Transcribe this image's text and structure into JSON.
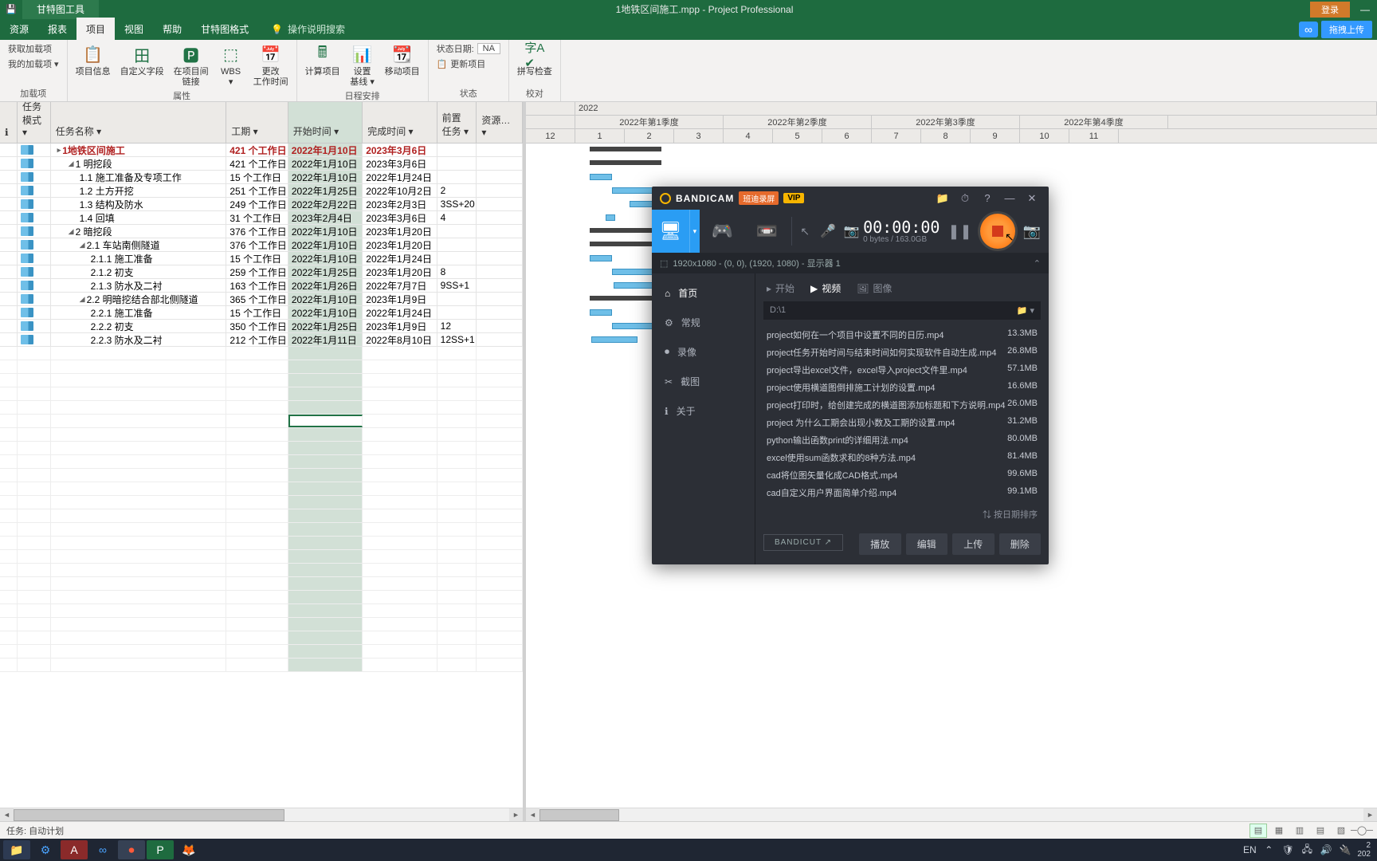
{
  "titlebar": {
    "contextual_tab": "甘特图工具",
    "title": "1地铁区间施工.mpp  -  Project Professional",
    "login": "登录"
  },
  "menu": {
    "tabs": [
      "资源",
      "报表",
      "项目",
      "视图",
      "帮助",
      "甘特图格式"
    ],
    "active_index": 2,
    "search_placeholder": "操作说明搜索",
    "upload": "拖拽上传"
  },
  "ribbon": {
    "g1": {
      "b1": "获取加载项",
      "b2": "我的加载项 ▾",
      "label": "加载项"
    },
    "g2": {
      "b1": "项目信息",
      "b2": "自定义字段",
      "b3": "在项目间\n链接",
      "b4": "WBS\n▾",
      "b5": "更改\n工作时间",
      "label": "属性"
    },
    "g3": {
      "b1": "计算项目",
      "b2": "设置\n基线 ▾",
      "b3": "移动项目",
      "label": "日程安排"
    },
    "g4": {
      "r1": "状态日期:",
      "r1v": "NA",
      "r2": "更新项目",
      "label": "状态"
    },
    "g5": {
      "b1": "拼写检查",
      "label": "校对"
    }
  },
  "columns": {
    "indicator": "",
    "mode": "任务模式 ▾",
    "name": "任务名称 ▾",
    "duration": "工期 ▾",
    "start": "开始时间 ▾",
    "finish": "完成时间 ▾",
    "pred": "前置\n任务 ▾",
    "res": "资源… ▾"
  },
  "tasks": [
    {
      "lvl": 0,
      "sum": true,
      "name": "1地铁区间施工",
      "dur": "421 个工作日",
      "start": "2022年1月10日",
      "finish": "2023年3月6日",
      "pred": "",
      "toggle": "▸"
    },
    {
      "lvl": 1,
      "sum": true,
      "name": "1 明挖段",
      "dur": "421 个工作日",
      "start": "2022年1月10日",
      "finish": "2023年3月6日",
      "pred": "",
      "toggle": "◢"
    },
    {
      "lvl": 2,
      "name": "1.1 施工准备及专项工作",
      "dur": "15 个工作日",
      "start": "2022年1月10日",
      "finish": "2022年1月24日",
      "pred": ""
    },
    {
      "lvl": 2,
      "name": "1.2 土方开挖",
      "dur": "251 个工作日",
      "start": "2022年1月25日",
      "finish": "2022年10月2日",
      "pred": "2"
    },
    {
      "lvl": 2,
      "name": "1.3 结构及防水",
      "dur": "249 个工作日",
      "start": "2022年2月22日",
      "finish": "2023年2月3日",
      "pred": "3SS+20"
    },
    {
      "lvl": 2,
      "name": "1.4 回填",
      "dur": "31 个工作日",
      "start": "2023年2月4日",
      "finish": "2023年3月6日",
      "pred": "4"
    },
    {
      "lvl": 1,
      "sum": true,
      "name": "2 暗挖段",
      "dur": "376 个工作日",
      "start": "2022年1月10日",
      "finish": "2023年1月20日",
      "pred": "",
      "toggle": "◢"
    },
    {
      "lvl": 2,
      "sum": true,
      "name": "2.1 车站南侧隧道",
      "dur": "376 个工作日",
      "start": "2022年1月10日",
      "finish": "2023年1月20日",
      "pred": "",
      "toggle": "◢"
    },
    {
      "lvl": 3,
      "name": "2.1.1 施工准备",
      "dur": "15 个工作日",
      "start": "2022年1月10日",
      "finish": "2022年1月24日",
      "pred": ""
    },
    {
      "lvl": 3,
      "name": "2.1.2 初支",
      "dur": "259 个工作日",
      "start": "2022年1月25日",
      "finish": "2023年1月20日",
      "pred": "8"
    },
    {
      "lvl": 3,
      "name": "2.1.3 防水及二衬",
      "dur": "163 个工作日",
      "start": "2022年1月26日",
      "finish": "2022年7月7日",
      "pred": "9SS+1"
    },
    {
      "lvl": 2,
      "sum": true,
      "name": "2.2 明暗挖结合部北侧隧道",
      "dur": "365 个工作日",
      "start": "2022年1月10日",
      "finish": "2023年1月9日",
      "pred": "",
      "toggle": "◢"
    },
    {
      "lvl": 3,
      "name": "2.2.1 施工准备",
      "dur": "15 个工作日",
      "start": "2022年1月10日",
      "finish": "2022年1月24日",
      "pred": ""
    },
    {
      "lvl": 3,
      "name": "2.2.2 初支",
      "dur": "350 个工作日",
      "start": "2022年1月25日",
      "finish": "2023年1月9日",
      "pred": "12"
    },
    {
      "lvl": 3,
      "name": "2.2.3 防水及二衬",
      "dur": "212 个工作日",
      "start": "2022年1月11日",
      "finish": "2022年8月10日",
      "pred": "12SS+1"
    }
  ],
  "timescale": {
    "year": "2022",
    "quarters": [
      "2022年第1季度",
      "2022年第2季度",
      "2022年第3季度",
      "2022年第4季度"
    ],
    "months": [
      "12",
      "1",
      "2",
      "3",
      "4",
      "5",
      "6",
      "7",
      "8",
      "9",
      "10",
      "11"
    ]
  },
  "bandicam": {
    "brand": "BANDICAM",
    "subtitle": "班迪录屏",
    "vip": "VIP",
    "timer": "00:00:00",
    "bytes": "0 bytes / 163.0GB",
    "capture_info": "1920x1080 - (0, 0), (1920, 1080) - 显示器 1",
    "side": [
      {
        "icon": "⌂",
        "label": "首页",
        "active": true
      },
      {
        "icon": "⚙",
        "label": "常规"
      },
      {
        "icon": "⏺",
        "label": "录像"
      },
      {
        "icon": "✂",
        "label": "截图"
      },
      {
        "icon": "ℹ",
        "label": "关于"
      }
    ],
    "tabs": [
      {
        "icon": "▸",
        "label": "开始"
      },
      {
        "icon": "▶",
        "label": "视频",
        "active": true
      },
      {
        "icon": "🖼",
        "label": "图像"
      }
    ],
    "path": "D:\\1",
    "path_icon": "📁 ▾",
    "files": [
      {
        "name": "project如何在一个项目中设置不同的日历.mp4",
        "size": "13.3MB"
      },
      {
        "name": "project任务开始时间与结束时间如何实现软件自动生成.mp4",
        "size": "26.8MB"
      },
      {
        "name": "project导出excel文件，excel导入project文件里.mp4",
        "size": "57.1MB"
      },
      {
        "name": "project使用横道图倒排施工计划的设置.mp4",
        "size": "16.6MB"
      },
      {
        "name": "project打印时，给创建完成的横道图添加标题和下方说明.mp4",
        "size": "26.0MB"
      },
      {
        "name": "project 为什么工期会出现小数及工期的设置.mp4",
        "size": "31.2MB"
      },
      {
        "name": "python输出函数print的详细用法.mp4",
        "size": "80.0MB"
      },
      {
        "name": "excel使用sum函数求和的8种方法.mp4",
        "size": "81.4MB"
      },
      {
        "name": "cad将位图矢量化成CAD格式.mp4",
        "size": "99.6MB"
      },
      {
        "name": "cad自定义用户界面简单介绍.mp4",
        "size": "99.1MB"
      }
    ],
    "sort": "⇅ 按日期排序",
    "bandicut": "BANDICUT ↗",
    "actions": [
      "播放",
      "编辑",
      "上传",
      "删除"
    ]
  },
  "statusbar": {
    "left": "任务: 自动计划"
  },
  "taskbar": {
    "lang": "EN",
    "time": "2\n202"
  }
}
